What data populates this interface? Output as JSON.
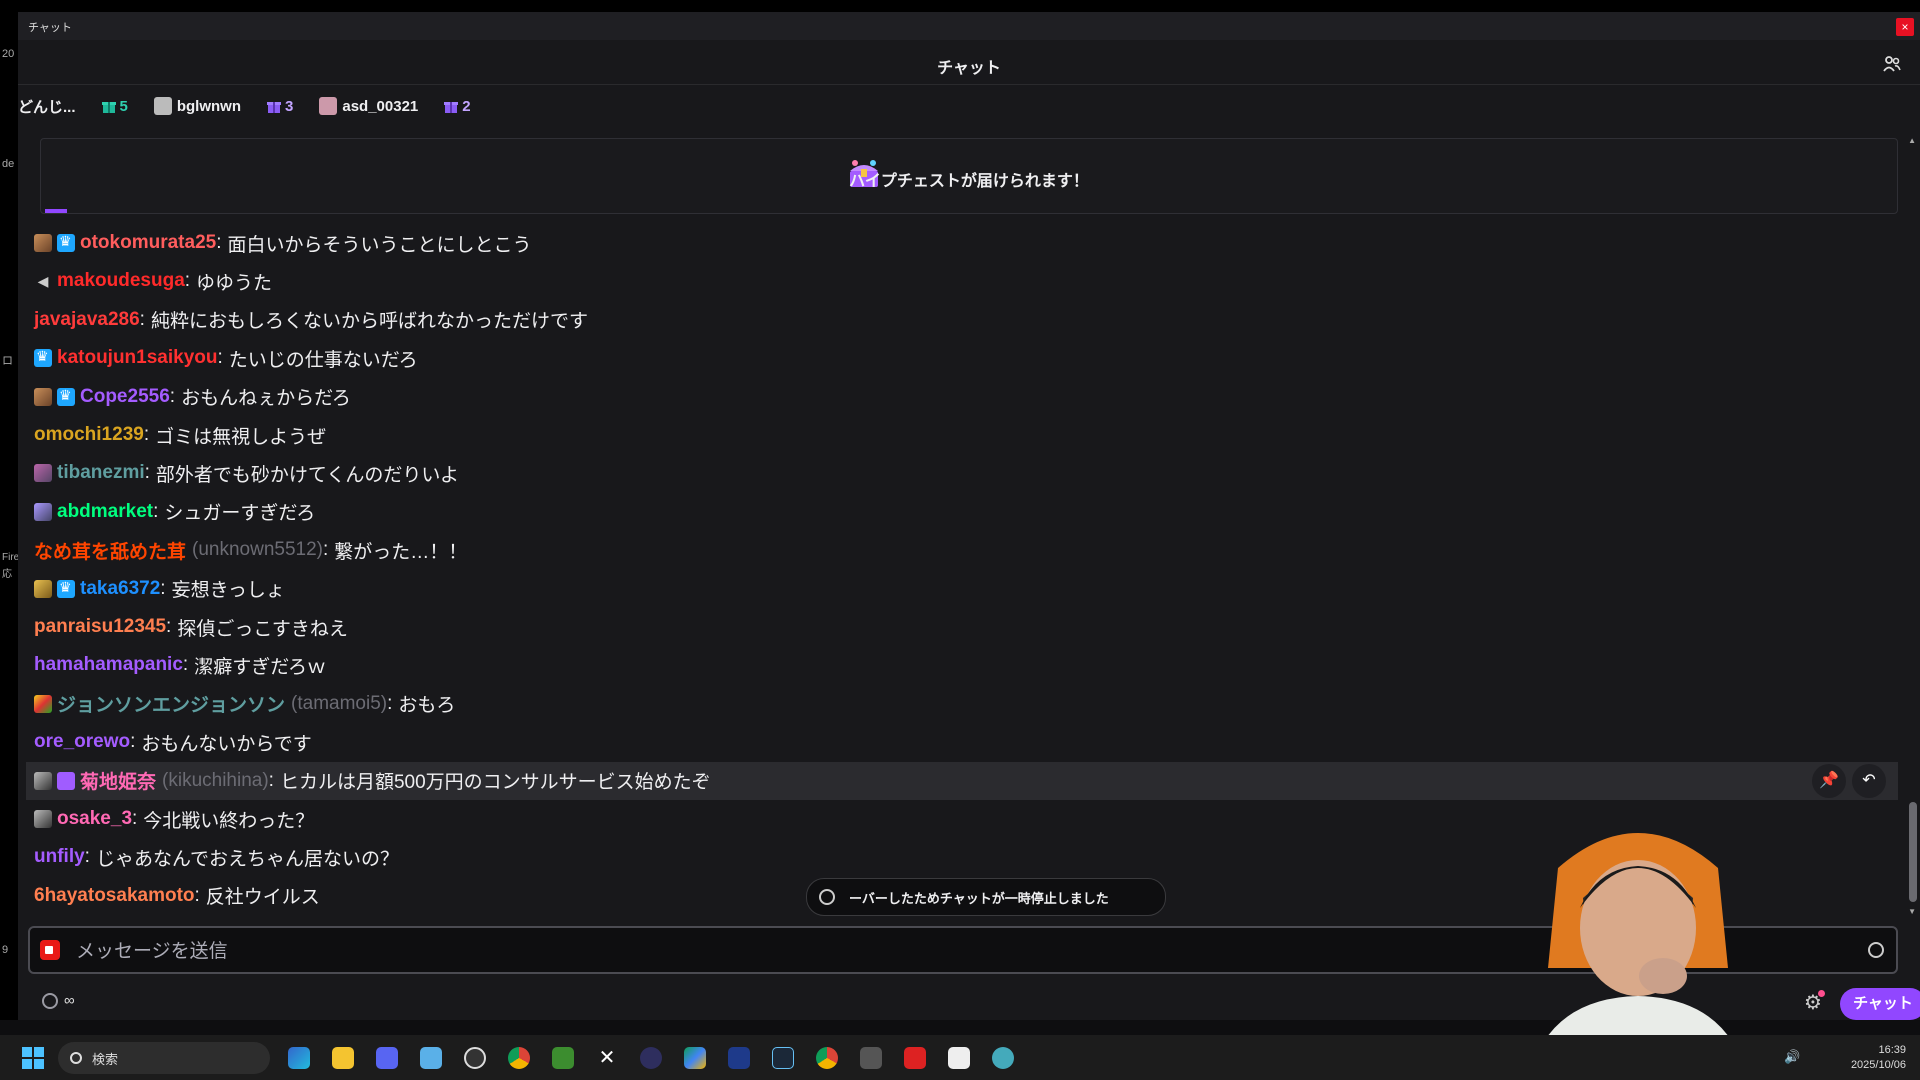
{
  "window": {
    "title": "チャット",
    "close_label": "×"
  },
  "header": {
    "title": "チャット"
  },
  "left_strip": [
    "20",
    "de",
    "ロ",
    "Fire",
    "応",
    "9"
  ],
  "gift_leaders": [
    {
      "name": "どんじ...",
      "count": "5"
    },
    {
      "name": "bglwnwn",
      "count": "3"
    },
    {
      "name": "asd_00321",
      "count": "2"
    }
  ],
  "hype_banner": {
    "text": "ハイプチェストが届けられます！"
  },
  "messages": [
    {
      "user": "otokomurata25",
      "color": "#ff5d5d",
      "badges": [
        "sub",
        "vip"
      ],
      "text": "面白いからそういうことにしとこう"
    },
    {
      "user": "makoudesuga",
      "color": "#ff2a2a",
      "badges": [
        "mute"
      ],
      "text": "ゆゆうた"
    },
    {
      "user": "javajava286",
      "color": "#ff3b3b",
      "badges": [],
      "text": "純粋におもしろくないから呼ばれなかっただけです"
    },
    {
      "user": "katoujun1saikyou",
      "color": "#ff3030",
      "badges": [
        "vip"
      ],
      "text": "たいじの仕事ないだろ"
    },
    {
      "user": "Cope2556",
      "color": "#a45cff",
      "badges": [
        "sub",
        "vip"
      ],
      "text": "おもんねぇからだろ"
    },
    {
      "user": "omochi1239",
      "color": "#daa520",
      "badges": [],
      "text": "ゴミは無視しようぜ"
    },
    {
      "user": "tibanezmi",
      "color": "#5f9ea0",
      "badges": [
        "pic"
      ],
      "text": "部外者でも砂かけてくんのだりいよ"
    },
    {
      "user": "abdmarket",
      "color": "#00ff7f",
      "badges": [
        "bot"
      ],
      "text": "シュガーすぎだろ"
    },
    {
      "user": "なめ茸を舐めた茸",
      "alt": "(unknown5512)",
      "color": "#ff4500",
      "badges": [],
      "text": "繋がった…！！"
    },
    {
      "user": "taka6372",
      "color": "#1e90ff",
      "badges": [
        "gold",
        "vip"
      ],
      "text": "妄想きっしょ"
    },
    {
      "user": "panraisu12345",
      "color": "#ff7f50",
      "badges": [],
      "text": "探偵ごっこすきねえ"
    },
    {
      "user": "hamahamapanic",
      "color": "#a45cff",
      "badges": [],
      "text": "潔癖すぎだろｗ"
    },
    {
      "user": "ジョンソンエンジョンソン",
      "alt": "(tamamoi5)",
      "color": "#5f9ea0",
      "badges": [
        "col"
      ],
      "text": "おもろ"
    },
    {
      "user": "ore_orewo",
      "color": "#a45cff",
      "badges": [],
      "text": "おもんないからです"
    },
    {
      "user": "菊地姫奈",
      "alt": "(kikuchihina)",
      "color": "#ff69b4",
      "badges": [
        "dark",
        "pur"
      ],
      "text": "ヒカルは月額500万円のコンサルサービス始めたぞ",
      "highlight": true
    },
    {
      "user": "osake_3",
      "color": "#ff69b4",
      "badges": [
        "dark"
      ],
      "text": "今北戦い終わった？"
    },
    {
      "user": "unfily",
      "color": "#a45cff",
      "badges": [],
      "text": "じゃあなんでおえちゃん居ないの？"
    },
    {
      "user": "6hayatosakamoto",
      "color": "#ff7f50",
      "badges": [],
      "text": "反社ウイルス"
    }
  ],
  "paused_notice": "ーバーしたためチャットが一時停止しました",
  "input": {
    "placeholder": "メッセージを送信"
  },
  "footer": {
    "timer": "∞",
    "chat_button": "チャット"
  },
  "taskbar": {
    "search_placeholder": "検索",
    "time": "16:39",
    "date": "2025/10/06"
  },
  "colors": {
    "accent": "#9147ff",
    "background": "#18181b"
  }
}
